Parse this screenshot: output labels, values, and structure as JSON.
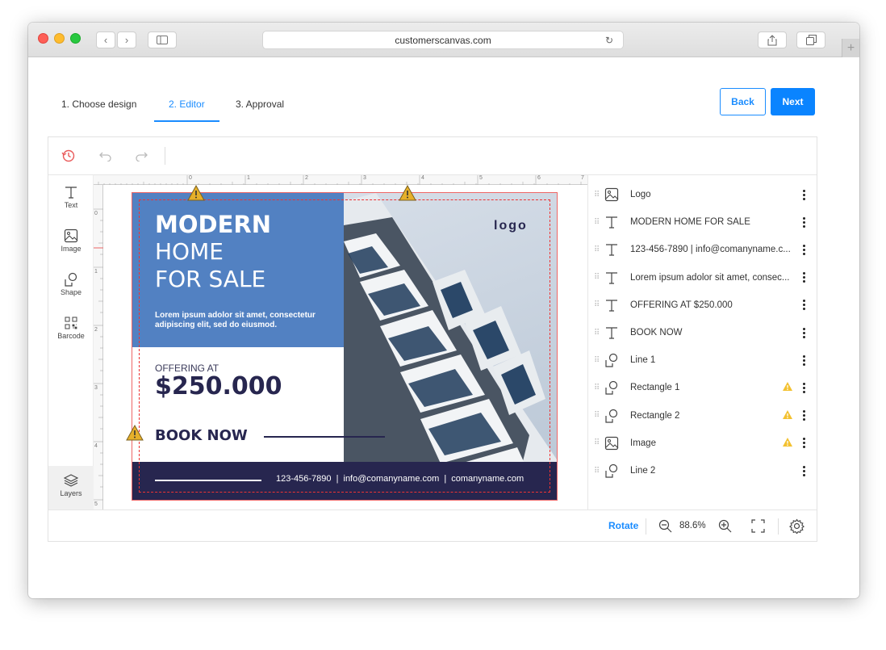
{
  "browser": {
    "url": "customerscanvas.com"
  },
  "steps": [
    {
      "label": "1. Choose design"
    },
    {
      "label": "2. Editor"
    },
    {
      "label": "3. Approval"
    }
  ],
  "buttons": {
    "back": "Back",
    "next": "Next"
  },
  "tools": [
    {
      "label": "Text",
      "icon": "text-icon"
    },
    {
      "label": "Image",
      "icon": "image-icon"
    },
    {
      "label": "Shape",
      "icon": "shape-icon"
    },
    {
      "label": "Barcode",
      "icon": "barcode-icon"
    }
  ],
  "layers_label": "Layers",
  "ruler": {
    "top": [
      "0",
      "1",
      "2",
      "3",
      "4",
      "5",
      "6",
      "7"
    ],
    "left": [
      "0",
      "1",
      "2",
      "3",
      "4",
      "5"
    ]
  },
  "design": {
    "headline_bold": "MODERN",
    "headline_line2": "HOME",
    "headline_line3": "FOR SALE",
    "body": "Lorem ipsum adolor sit amet, consectetur adipiscing elit, sed do eiusmod.",
    "offering_label": "OFFERING AT",
    "price": "$250.000",
    "cta": "BOOK NOW",
    "logo": "logo",
    "footer_phone": "123-456-7890",
    "footer_email": "info@comanyname.com",
    "footer_site": "comanyname.com",
    "footer_sep": "|",
    "colors": {
      "blue": "#5281c2",
      "navy": "#27264f",
      "sky": "#c8d4e2"
    }
  },
  "layers": [
    {
      "name": "Logo",
      "icon": "image-icon",
      "warning": false
    },
    {
      "name": "MODERN HOME FOR SALE",
      "icon": "text-icon",
      "warning": false
    },
    {
      "name": "123-456-7890 | info@comanyname.c...",
      "icon": "text-icon",
      "warning": false
    },
    {
      "name": "Lorem ipsum adolor sit amet, consec...",
      "icon": "text-icon",
      "warning": false
    },
    {
      "name": "OFFERING AT $250.000",
      "icon": "text-icon",
      "warning": false
    },
    {
      "name": "BOOK NOW",
      "icon": "text-icon",
      "warning": false
    },
    {
      "name": "Line 1",
      "icon": "shape-icon",
      "warning": false
    },
    {
      "name": "Rectangle 1",
      "icon": "shape-icon",
      "warning": true
    },
    {
      "name": "Rectangle 2",
      "icon": "shape-icon",
      "warning": true
    },
    {
      "name": "Image",
      "icon": "image-icon",
      "warning": true
    },
    {
      "name": "Line 2",
      "icon": "shape-icon",
      "warning": false
    }
  ],
  "bottom": {
    "rotate": "Rotate",
    "zoom": "88.6%"
  },
  "accent": "#1a8cff",
  "warning_color": "#f3c130"
}
